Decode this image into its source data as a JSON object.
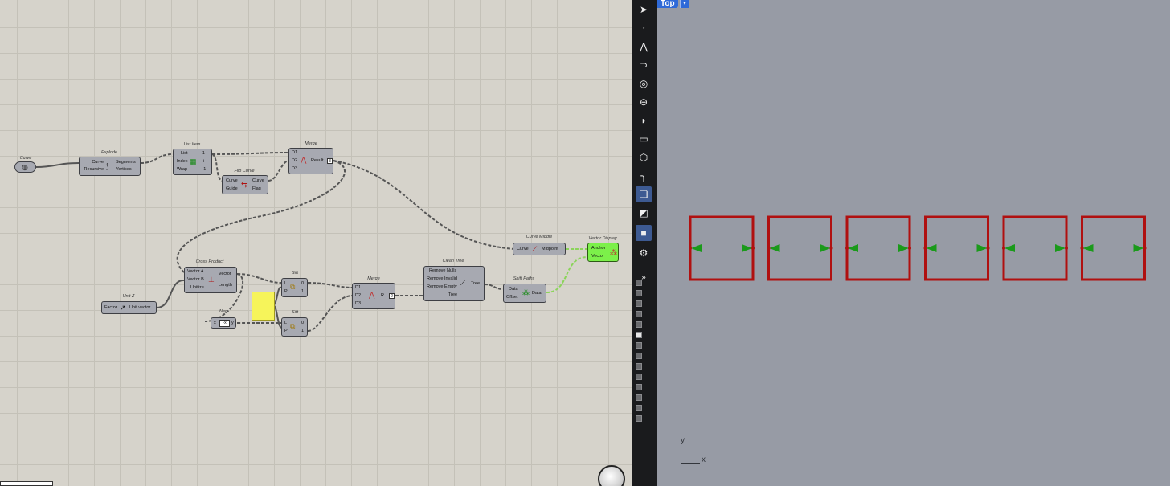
{
  "grasshopper": {
    "components": {
      "curve": {
        "title": "Curve"
      },
      "explode": {
        "title": "Explode",
        "inputs": [
          "Curve",
          "Recursive"
        ],
        "outputs": [
          "Segments",
          "Vertices"
        ]
      },
      "list_item": {
        "title": "List Item",
        "inputs": [
          "List",
          "Index",
          "Wrap"
        ],
        "outputs": [
          "-1",
          "i",
          "+1"
        ]
      },
      "flip_curve": {
        "title": "Flip Curve",
        "inputs": [
          "Curve",
          "Guide"
        ],
        "outputs": [
          "Curve",
          "Flag"
        ]
      },
      "merge_top": {
        "title": "Merge",
        "inputs": [
          "D1",
          "D2",
          "D3"
        ],
        "output": "Result",
        "count": "3"
      },
      "curve_middle": {
        "title": "Curve Middle",
        "input": "Curve",
        "output": "Midpoint"
      },
      "vector_display": {
        "title": "Vector Display",
        "inputs": [
          "Anchor",
          "Vector"
        ]
      },
      "cross_product": {
        "title": "Cross Product",
        "inputs": [
          "Vector A",
          "Vector B",
          "Unitize"
        ],
        "outputs": [
          "Vector",
          "Length"
        ]
      },
      "unit_z": {
        "title": "Unit Z",
        "input": "Factor",
        "output": "Unit vector"
      },
      "neg": {
        "title": "Neg",
        "input": "x",
        "symbol": "-x",
        "output": "y"
      },
      "sift_top": {
        "title": "Sift",
        "inputs": [
          "L",
          "P"
        ],
        "outputs": [
          "0",
          "1"
        ]
      },
      "sift_bottom": {
        "title": "Sift",
        "inputs": [
          "L",
          "P"
        ],
        "outputs": [
          "0",
          "1"
        ]
      },
      "merge_bottom": {
        "title": "Merge",
        "inputs": [
          "D1",
          "D2",
          "D3"
        ],
        "output": "R",
        "count": "2"
      },
      "clean_tree": {
        "title": "Clean Tree",
        "inputs": [
          "Remove Nulls",
          "Remove Invalid",
          "Remove Empty",
          "Tree"
        ],
        "output": "Tree"
      },
      "shift_paths": {
        "title": "Shift Paths",
        "inputs": [
          "Data",
          "Offset"
        ],
        "output": "Data"
      }
    }
  },
  "rhino": {
    "viewport_tab": "Top",
    "axis_x": "x",
    "axis_y": "y",
    "rect_count": 6,
    "colors": {
      "rect": "#b01010",
      "arrow": "#1a9a1a",
      "viewport_bg": "#979ba5",
      "canvas_bg": "#d6d3cb",
      "selected": "#7cf04a"
    },
    "toolbar_icons": [
      "select-arrow-icon",
      "point-icon",
      "polyline-icon",
      "curve-icon",
      "circle-icon",
      "ellipse-icon",
      "arc-icon",
      "rectangle-icon",
      "polygon-icon",
      "fillet-icon",
      "extrude-icon",
      "surface-icon",
      "box-icon",
      "gear-icon"
    ],
    "expand_glyph": "»"
  }
}
